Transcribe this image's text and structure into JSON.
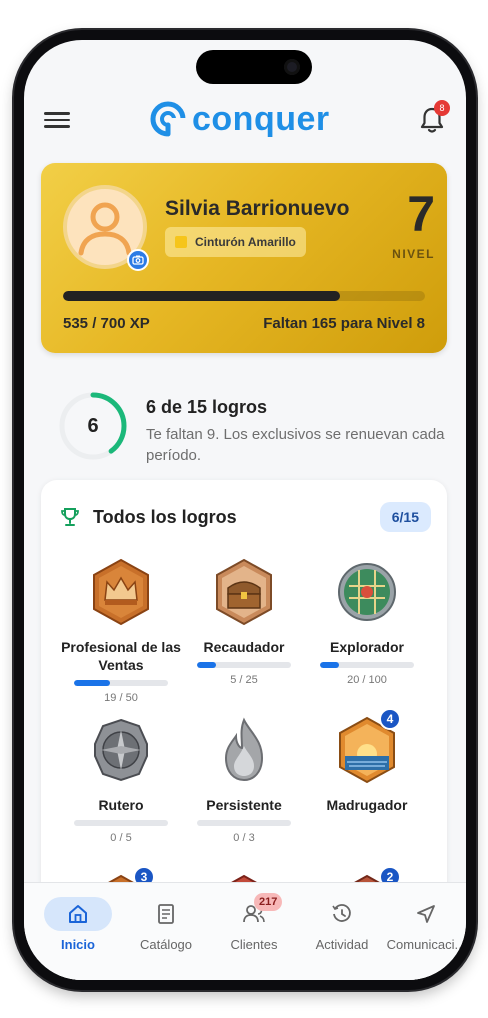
{
  "header": {
    "logo_text": "conquer",
    "notification_count": "8"
  },
  "profile": {
    "name": "Silvia Barrionuevo",
    "belt": "Cinturón Amarillo",
    "level": "7",
    "level_label": "NIVEL",
    "xp_text": "535 / 700 XP",
    "xp_progress": 0.764,
    "remaining_text": "Faltan 165 para Nivel 8"
  },
  "summary": {
    "ring_value": "6",
    "ring_progress": 0.4,
    "title": "6 de 15 logros",
    "subtitle": "Te faltan 9. Los exclusivos se renuevan cada período."
  },
  "achievements": {
    "title": "Todos los logros",
    "count": "6/15",
    "items": [
      {
        "label": "Profesional de las Ventas",
        "progress_text": "19 / 50",
        "progress": 0.38
      },
      {
        "label": "Recaudador",
        "progress_text": "5 / 25",
        "progress": 0.2
      },
      {
        "label": "Explorador",
        "progress_text": "20 / 100",
        "progress": 0.2
      },
      {
        "label": "Rutero",
        "progress_text": "0 / 5",
        "progress": 0
      },
      {
        "label": "Persistente",
        "progress_text": "0 / 3",
        "progress": 0
      },
      {
        "label": "Madrugador",
        "badge": "4"
      }
    ],
    "partial_row_badges": [
      "3",
      "2"
    ]
  },
  "nav": {
    "items": [
      {
        "label": "Inicio"
      },
      {
        "label": "Catálogo"
      },
      {
        "label": "Clientes",
        "badge": "217"
      },
      {
        "label": "Actividad"
      },
      {
        "label": "Comunicaci..."
      }
    ]
  },
  "colors": {
    "brand": "#1f8fe6",
    "gold": "#e6b724",
    "active_nav": "#1a64d8",
    "progress": "#1a73e8"
  }
}
